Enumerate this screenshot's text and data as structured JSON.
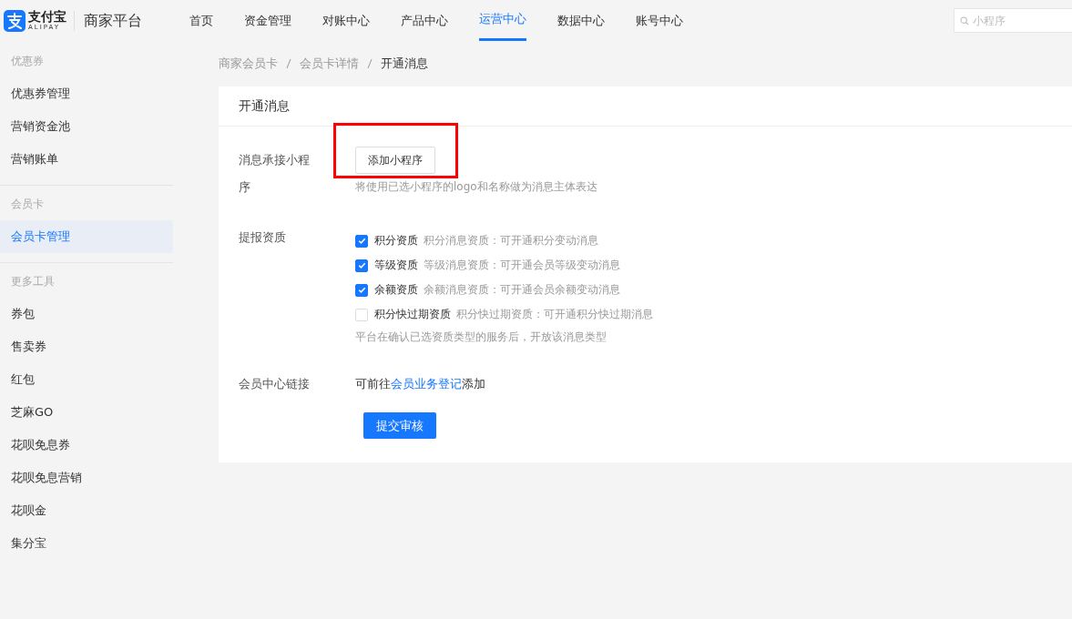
{
  "header": {
    "logo_text": "支付宝",
    "logo_subtext": "ALIPAY",
    "platform": "商家平台",
    "nav": [
      {
        "label": "首页",
        "selected": false
      },
      {
        "label": "资金管理",
        "selected": false
      },
      {
        "label": "对账中心",
        "selected": false
      },
      {
        "label": "产品中心",
        "selected": false
      },
      {
        "label": "运营中心",
        "selected": true
      },
      {
        "label": "数据中心",
        "selected": false
      },
      {
        "label": "账号中心",
        "selected": false
      }
    ],
    "search": {
      "placeholder": "小程序"
    }
  },
  "sidebar": {
    "groups": [
      {
        "title": "优惠券",
        "items": [
          {
            "label": "优惠券管理",
            "selected": false
          },
          {
            "label": "营销资金池",
            "selected": false
          },
          {
            "label": "营销账单",
            "selected": false
          }
        ]
      },
      {
        "title": "会员卡",
        "items": [
          {
            "label": "会员卡管理",
            "selected": true
          }
        ]
      },
      {
        "title": "更多工具",
        "items": [
          {
            "label": "券包",
            "selected": false
          },
          {
            "label": "售卖券",
            "selected": false
          },
          {
            "label": "红包",
            "selected": false
          },
          {
            "label": "芝麻GO",
            "selected": false
          },
          {
            "label": "花呗免息券",
            "selected": false
          },
          {
            "label": "花呗免息营销",
            "selected": false
          },
          {
            "label": "花呗金",
            "selected": false
          },
          {
            "label": "集分宝",
            "selected": false
          }
        ]
      }
    ]
  },
  "breadcrumb": [
    {
      "label": "商家会员卡"
    },
    {
      "label": "会员卡详情"
    },
    {
      "label": "开通消息"
    }
  ],
  "card": {
    "title": "开通消息",
    "miniapp_row": {
      "label": "消息承接小程序",
      "button": "添加小程序",
      "highlighted": true,
      "help": "将使用已选小程序的logo和名称做为消息主体表达"
    },
    "qualification_row": {
      "label": "提报资质",
      "options": [
        {
          "name": "积分资质",
          "desc": "积分消息资质：可开通积分变动消息",
          "checked": true
        },
        {
          "name": "等级资质",
          "desc": "等级消息资质：可开通会员等级变动消息",
          "checked": true
        },
        {
          "name": "余额资质",
          "desc": "余额消息资质：可开通会员余额变动消息",
          "checked": true
        },
        {
          "name": "积分快过期资质",
          "desc": "积分快过期资质：可开通积分快过期消息",
          "checked": false
        }
      ],
      "help": "平台在确认已选资质类型的服务后，开放该消息类型"
    },
    "link_row": {
      "label": "会员中心链接",
      "before": "可前往",
      "link": "会员业务登记",
      "after": "添加"
    },
    "submit": "提交审核"
  }
}
